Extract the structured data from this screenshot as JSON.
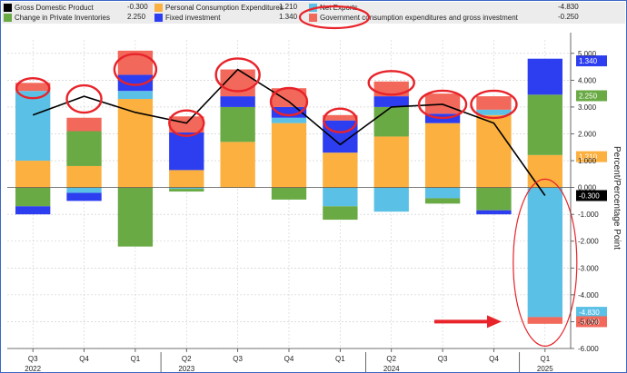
{
  "legend": [
    {
      "name": "Gross Domestic Product",
      "value": "-0.300",
      "color": "#000000"
    },
    {
      "name": "Personal Consumption Expenditures",
      "value": "1.210",
      "color": "#fbb040"
    },
    {
      "name": "Net Exports",
      "value": "-4.830",
      "color": "#5bc0e6"
    },
    {
      "name": "Change in Private Inventories",
      "value": "2.250",
      "color": "#6aaa45"
    },
    {
      "name": "Fixed investment",
      "value": "1.340",
      "color": "#2d3df0"
    },
    {
      "name": "Government consumption expenditures and gross investment",
      "value": "-0.250",
      "color": "#f2685a"
    }
  ],
  "chart_data": {
    "type": "bar",
    "stacked": true,
    "categories": [
      "Q3 2022",
      "Q4 2022",
      "Q1 2023",
      "Q2 2023",
      "Q3 2023",
      "Q4 2023",
      "Q1 2024",
      "Q2 2024",
      "Q3 2024",
      "Q4 2024",
      "Q1 2025"
    ],
    "x_ticks": [
      "Q3",
      "Q4",
      "Q1",
      "Q2",
      "Q3",
      "Q4",
      "Q1",
      "Q2",
      "Q3",
      "Q4",
      "Q1"
    ],
    "x_years": [
      {
        "label": "2022",
        "at": 0
      },
      {
        "label": "2023",
        "at": 3
      },
      {
        "label": "2024",
        "at": 7
      },
      {
        "label": "2025",
        "at": 10
      }
    ],
    "ylabel": "Percent/Percentage Point",
    "ylim": [
      -6,
      5.5
    ],
    "yticks": [
      -6,
      -5,
      -4,
      -3,
      -2,
      -1,
      0,
      1,
      2,
      3,
      4,
      5
    ],
    "ytick_labels": [
      "-6.000",
      "-5.000",
      "-4.000",
      "-3.000",
      "-2.000",
      "-1.000",
      "0.000",
      "1.000",
      "2.000",
      "3.000",
      "4.000",
      "5.000"
    ],
    "series": [
      {
        "name": "Personal Consumption Expenditures",
        "color": "#fbb040",
        "values": [
          1.0,
          0.8,
          3.3,
          0.65,
          1.7,
          2.4,
          1.3,
          1.9,
          2.4,
          2.7,
          1.21
        ]
      },
      {
        "name": "Net Exports",
        "color": "#5bc0e6",
        "values": [
          2.6,
          -0.2,
          0.3,
          -0.05,
          0.0,
          0.2,
          -0.7,
          -0.9,
          -0.4,
          0.2,
          -4.83
        ]
      },
      {
        "name": "Change in Private Inventories",
        "color": "#6aaa45",
        "values": [
          -0.7,
          1.3,
          -2.2,
          -0.1,
          1.3,
          -0.45,
          -0.5,
          1.1,
          -0.2,
          -0.85,
          2.25
        ]
      },
      {
        "name": "Fixed investment",
        "color": "#2d3df0",
        "values": [
          -0.3,
          -0.3,
          0.6,
          1.4,
          0.4,
          0.4,
          1.2,
          0.4,
          0.35,
          -0.15,
          1.34
        ]
      },
      {
        "name": "Government consumption expenditures and gross investment",
        "color": "#f2685a",
        "values": [
          0.3,
          0.5,
          0.9,
          0.6,
          1.0,
          0.7,
          0.2,
          0.55,
          0.75,
          0.5,
          -0.25
        ]
      }
    ],
    "line": {
      "name": "Gross Domestic Product",
      "color": "#000000",
      "values": [
        2.7,
        3.4,
        2.8,
        2.4,
        4.4,
        3.2,
        1.6,
        3.0,
        3.1,
        2.4,
        -0.3
      ]
    },
    "value_labels": [
      {
        "text": "1.340",
        "y": 4.72,
        "color": "#2d3df0"
      },
      {
        "text": "2.250",
        "y": 3.42,
        "color": "#6aaa45"
      },
      {
        "text": "1.210",
        "y": 1.15,
        "color": "#fbb040"
      },
      {
        "text": "-0.300",
        "y": -0.3,
        "color": "#000000"
      },
      {
        "text": "-4.830",
        "y": -4.65,
        "color": "#5bc0e6"
      },
      {
        "text": "-0.250",
        "y": -5.0,
        "color": "#f2685a"
      }
    ]
  }
}
